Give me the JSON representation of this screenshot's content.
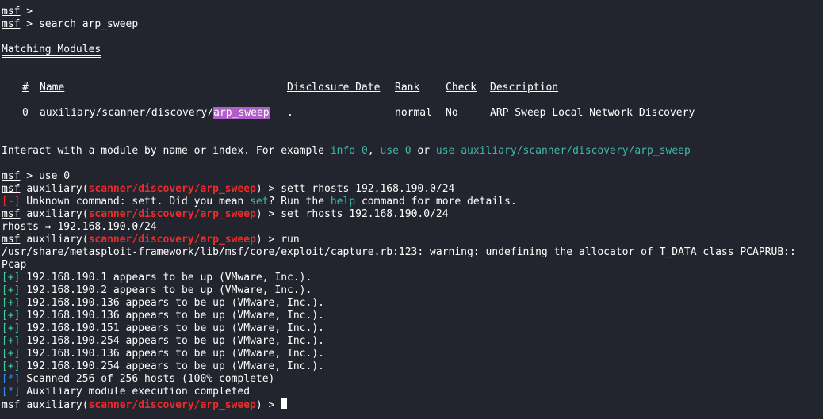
{
  "prompt": "msf",
  "gt": " > ",
  "aux_prefix": "auxiliary(",
  "aux_suffix": ")",
  "module_path": "scanner/discovery/arp_sweep",
  "cmd_search": "search arp_sweep",
  "matching_title": "Matching Modules",
  "table": {
    "headers": [
      "#",
      "Name",
      "Disclosure Date",
      "Rank",
      "Check",
      "Description"
    ],
    "row": {
      "index": "0",
      "name_prefix": "auxiliary/scanner/discovery/",
      "name_match": "arp_sweep",
      "date": ".",
      "rank": "normal",
      "check": "No",
      "description": "ARP Sweep Local Network Discovery"
    }
  },
  "interact": {
    "t1": "Interact with a module by name or index. For example ",
    "c1": "info 0",
    "t2": ", ",
    "c2": "use 0",
    "t3": " or ",
    "c3": "use auxiliary/scanner/discovery/arp_sweep"
  },
  "cmd_use": "use 0",
  "cmd_sett": "sett rhosts 192.168.190.0/24",
  "unknown": {
    "tag": "[-]",
    "t1": " Unknown command: sett. Did you mean ",
    "c1": "set",
    "t2": "? Run the ",
    "c2": "help",
    "t3": " command for more details."
  },
  "cmd_set": "set rhosts 192.168.190.0/24",
  "rhosts_out": "rhosts ⇒ 192.168.190.0/24",
  "cmd_run": "run",
  "warning": "/usr/share/metasploit-framework/lib/msf/core/exploit/capture.rb:123: warning: undefining the allocator of T_DATA class PCAPRUB::",
  "warning_cont": "Pcap",
  "plus_tag": "[+]",
  "star_tag": "[*]",
  "results": [
    " 192.168.190.1 appears to be up (VMware, Inc.).",
    " 192.168.190.2 appears to be up (VMware, Inc.).",
    " 192.168.190.136 appears to be up (VMware, Inc.).",
    " 192.168.190.136 appears to be up (VMware, Inc.).",
    " 192.168.190.151 appears to be up (VMware, Inc.).",
    " 192.168.190.254 appears to be up (VMware, Inc.).",
    " 192.168.190.136 appears to be up (VMware, Inc.).",
    " 192.168.190.254 appears to be up (VMware, Inc.)."
  ],
  "scanned": " Scanned 256 of 256 hosts (100% complete)",
  "completed": " Auxiliary module execution completed",
  "colors": {
    "background": "#23252e",
    "module": "#ee2b2b",
    "success": "#3ecc9c",
    "info": "#3d88f0",
    "highlight": "#b05ec8"
  }
}
